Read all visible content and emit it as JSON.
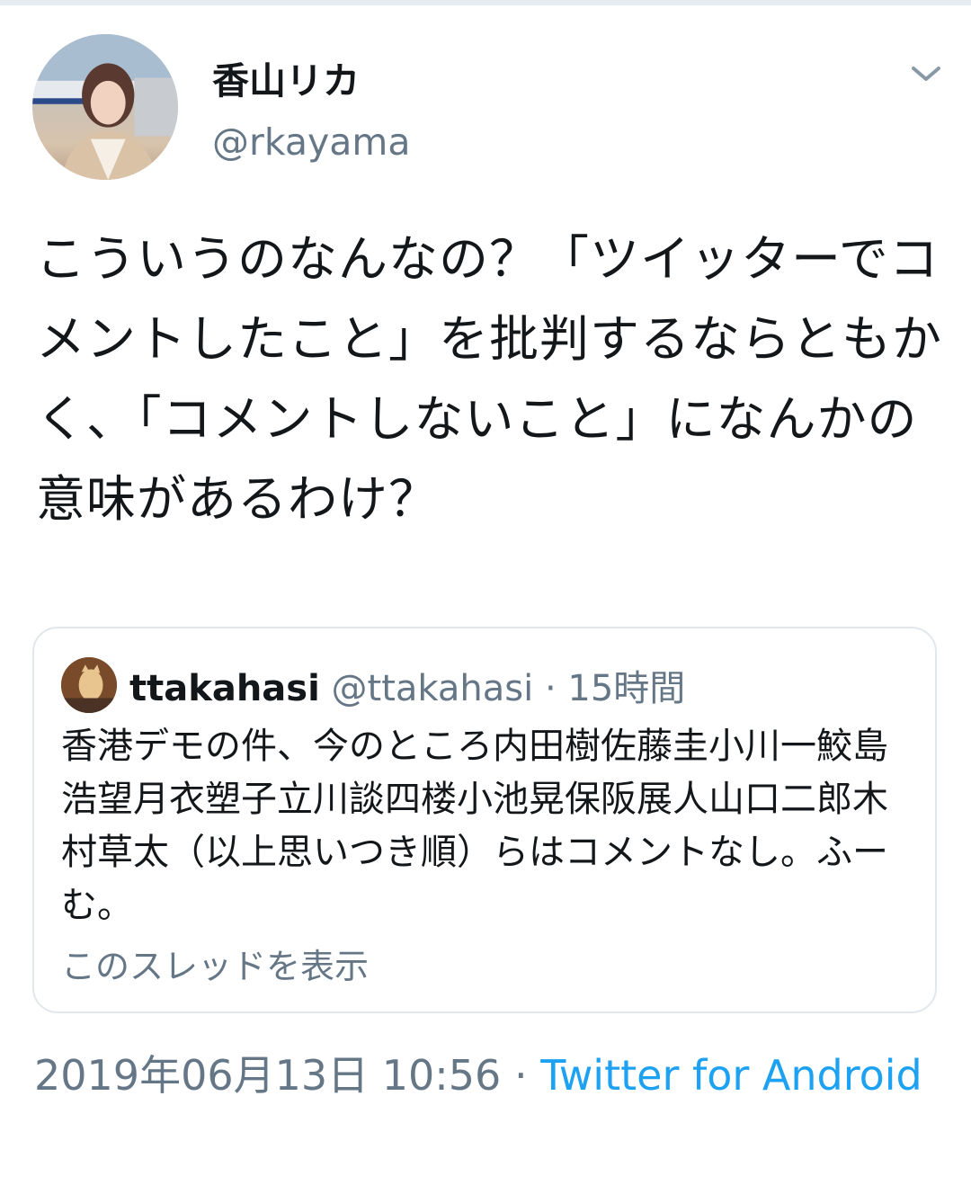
{
  "tweet": {
    "author": {
      "display_name": "香山リカ",
      "handle": "@rkayama"
    },
    "text": "こういうのなんなの？「ツイッターでコメントしたこと」を批判するならともかく、「コメントしないこと」になんかの意味があるわけ？",
    "quoted": {
      "display_name": "ttakahasi",
      "handle": "@ttakahasi",
      "separator": " · ",
      "time": "15時間",
      "text": "香港デモの件、今のところ内田樹佐藤圭小川一鮫島浩望月衣塑子立川談四楼小池晃保阪展人山口二郎木村草太（以上思いつき順）らはコメントなし。ふーむ。",
      "show_thread": "このスレッドを表示"
    },
    "timestamp": "2019年06月13日 10:56",
    "separator": " · ",
    "source": "Twitter for Android"
  },
  "icons": {
    "caret": "chevron-down-icon",
    "avatar": "profile-photo",
    "quoted_avatar": "cat-photo"
  },
  "colors": {
    "text": "#14171a",
    "secondary": "#657786",
    "link": "#1da1f2",
    "border": "#e1e8ed"
  }
}
